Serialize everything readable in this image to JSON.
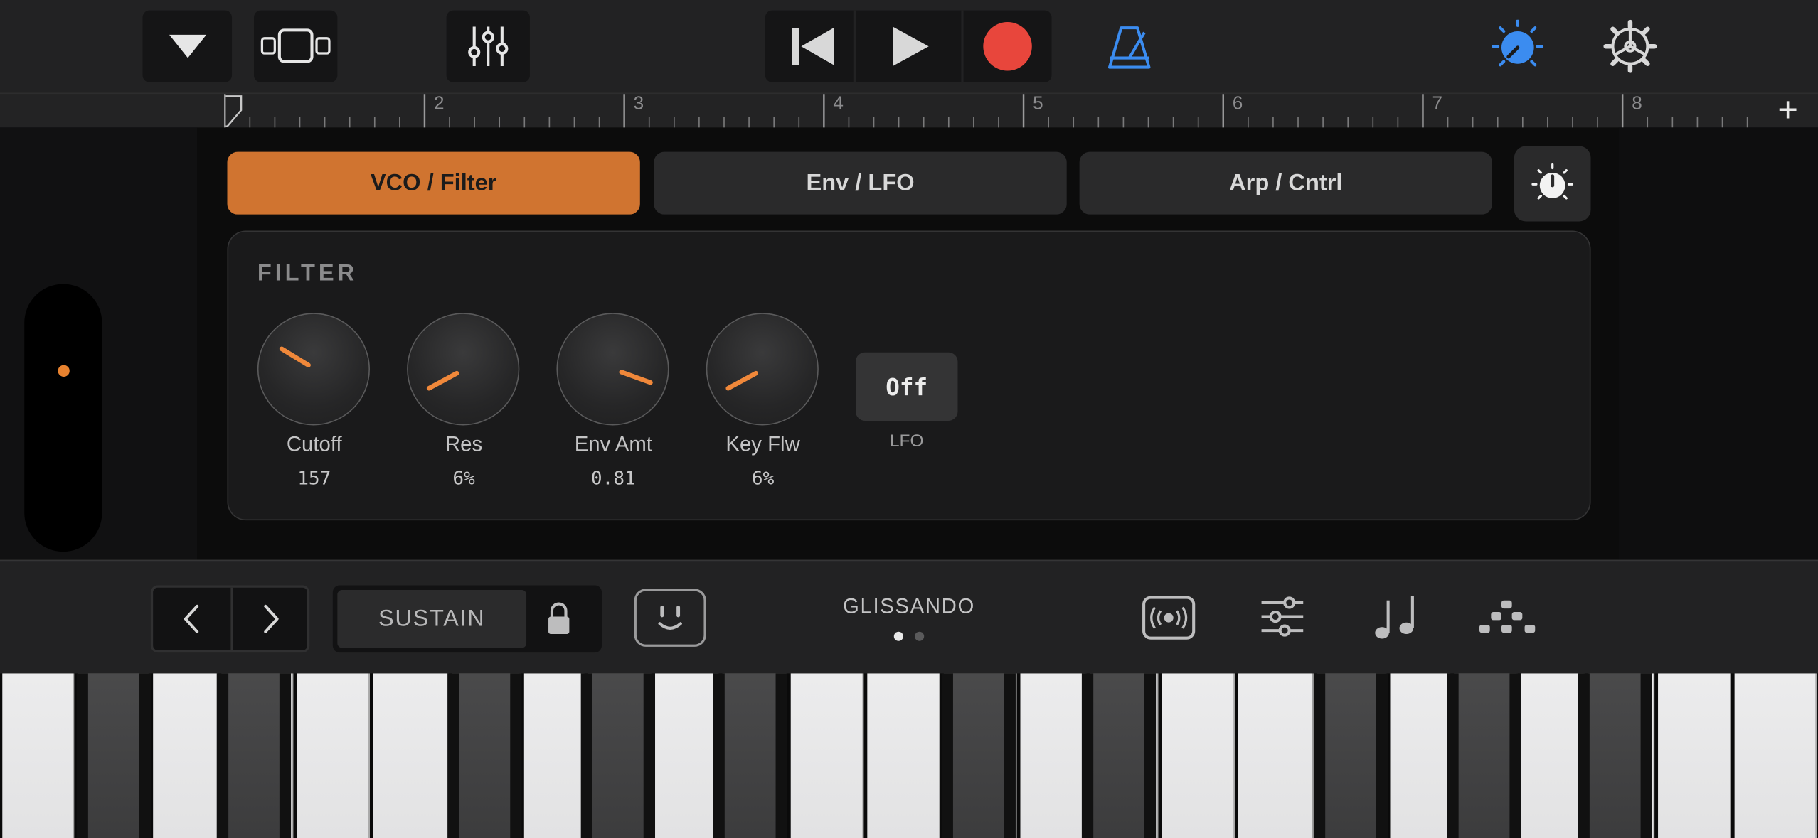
{
  "toolbar": {
    "browser_icon": "triangle-down-icon",
    "tracks_view_icon": "tracks-view-icon",
    "mixer_icon": "mixer-icon",
    "rewind_icon": "rewind-icon",
    "play_icon": "play-icon",
    "record_icon": "record-icon",
    "metronome_icon": "metronome-icon",
    "master_volume_icon": "master-knob-icon",
    "settings_icon": "gear-icon",
    "accent_color": "#3b8cf0",
    "record_color": "#e8463c"
  },
  "ruler": {
    "numbers": [
      "2",
      "3",
      "4",
      "5",
      "6",
      "7",
      "8"
    ],
    "add_label": "+"
  },
  "tabs": [
    {
      "label": "VCO / Filter",
      "active": true
    },
    {
      "label": "Env / LFO",
      "active": false
    },
    {
      "label": "Arp / Cntrl",
      "active": false
    }
  ],
  "filter": {
    "title": "FILTER",
    "knobs": [
      {
        "label": "Cutoff",
        "value": "157"
      },
      {
        "label": "Res",
        "value": "6%"
      },
      {
        "label": "Env Amt",
        "value": "0.81"
      },
      {
        "label": "Key Flw",
        "value": "6%"
      }
    ],
    "lfo": {
      "value": "Off",
      "label": "LFO"
    }
  },
  "controls": {
    "sustain": "SUSTAIN",
    "glissando": "GLISSANDO",
    "page_count": 2,
    "active_page": 1,
    "accent_color": "#d07430"
  }
}
